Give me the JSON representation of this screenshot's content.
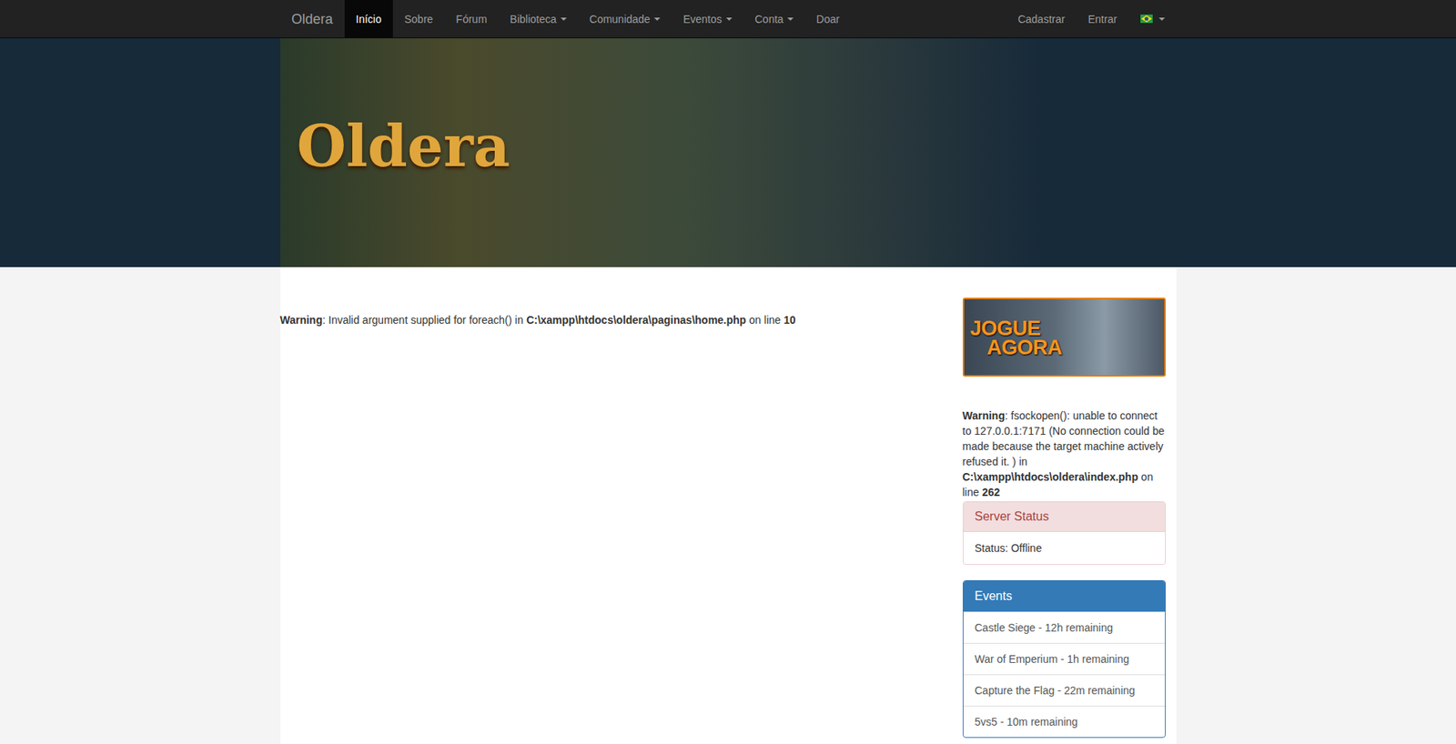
{
  "navbar": {
    "brand": "Oldera",
    "items": [
      {
        "label": "Início",
        "selected": true,
        "dropdown": false
      },
      {
        "label": "Sobre",
        "selected": false,
        "dropdown": false
      },
      {
        "label": "Fórum",
        "selected": false,
        "dropdown": false
      },
      {
        "label": "Biblioteca",
        "selected": false,
        "dropdown": true
      },
      {
        "label": "Comunidade",
        "selected": false,
        "dropdown": true
      },
      {
        "label": "Eventos",
        "selected": false,
        "dropdown": true
      },
      {
        "label": "Conta",
        "selected": false,
        "dropdown": true
      },
      {
        "label": "Doar",
        "selected": false,
        "dropdown": false
      }
    ],
    "right": [
      {
        "label": "Cadastrar"
      },
      {
        "label": "Entrar"
      }
    ]
  },
  "banner": {
    "logo": "Oldera"
  },
  "main_warning": {
    "label": "Warning",
    "message": ": Invalid argument supplied for foreach() in ",
    "file": "C:\\xampp\\htdocs\\oldera\\paginas\\home.php",
    "middle": " on line ",
    "line": "10"
  },
  "play_button": {
    "line1": "JOGUE",
    "line2": "AGORA"
  },
  "sidebar_warning": {
    "label": "Warning",
    "message": ": fsockopen(): unable to connect to 127.0.0.1:7171 (No connection could be made because the target machine actively refused it. ) in ",
    "file": "C:\\xampp\\htdocs\\oldera\\index.php",
    "middle": " on line ",
    "line": "262"
  },
  "server_status": {
    "title": "Server Status",
    "status": "Status: Offline"
  },
  "events": {
    "title": "Events",
    "items": [
      "Castle Siege - 12h remaining",
      "War of Emperium - 1h remaining",
      "Capture the Flag - 22m remaining",
      "5vs5 - 10m remaining"
    ]
  }
}
